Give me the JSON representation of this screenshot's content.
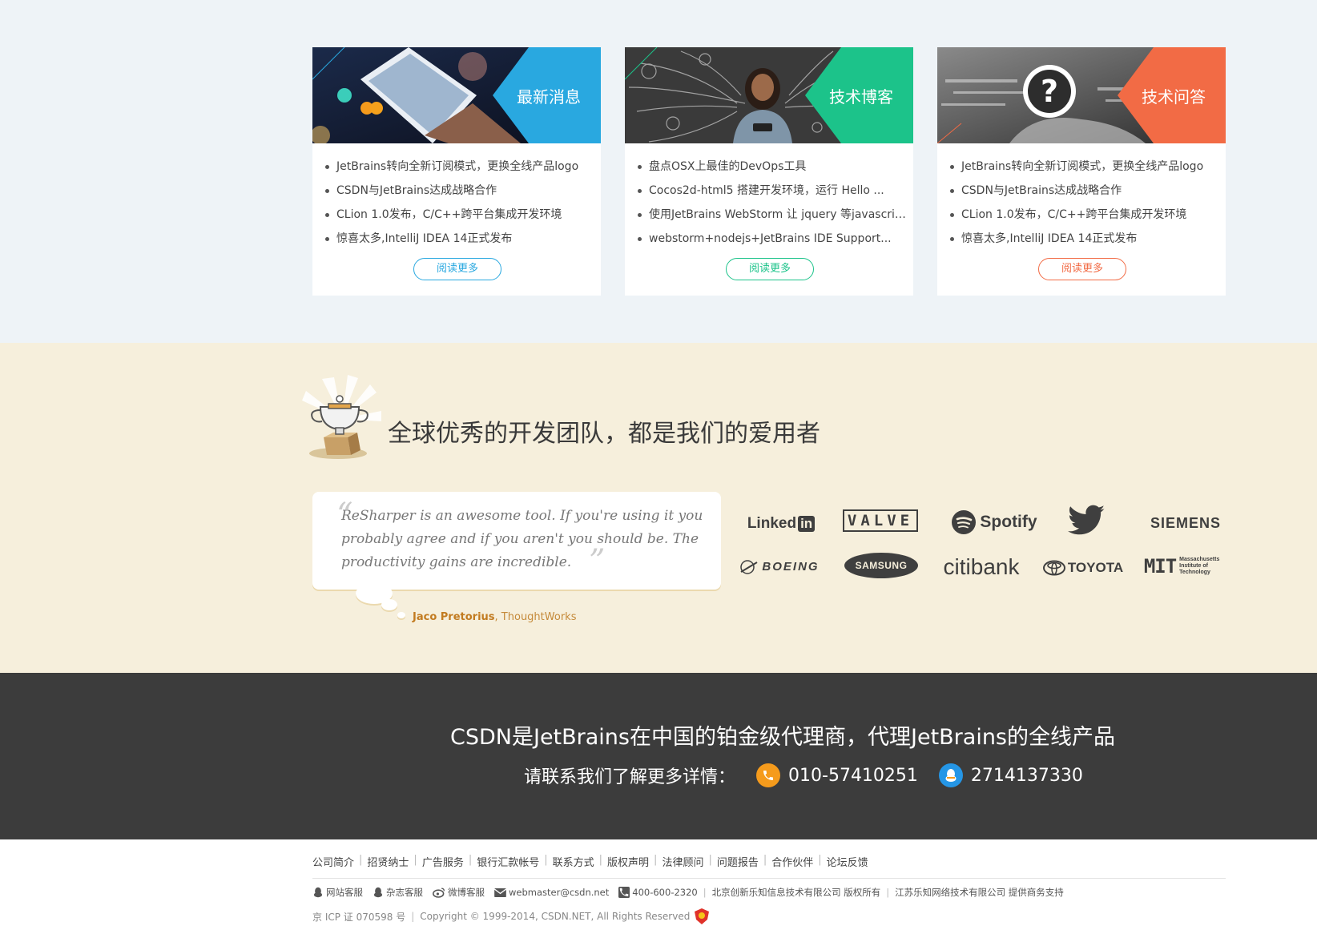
{
  "colors": {
    "news_accent": "#29a8e0",
    "blog_accent": "#1cc38a",
    "qa_accent": "#f26b45",
    "users_bg": "#f6efdc",
    "contact_bg": "#3c3c3c"
  },
  "cards": [
    {
      "title": "最新消息",
      "items": [
        "JetBrains转向全新订阅模式，更换全线产品logo",
        "CSDN与JetBrains达成战略合作",
        "CLion 1.0发布，C/C++跨平台集成开发环境",
        "惊喜太多,IntelliJ IDEA 14正式发布"
      ],
      "more": "阅读更多"
    },
    {
      "title": "技术博客",
      "items": [
        "盘点OSX上最佳的DevOps工具",
        "Cocos2d-html5 搭建开发环境，运行 Hello ...",
        "使用JetBrains WebStorm 让 jquery 等javascript...",
        "webstorm+nodejs+JetBrains IDE Support..."
      ],
      "more": "阅读更多"
    },
    {
      "title": "技术问答",
      "items": [
        "JetBrains转向全新订阅模式，更换全线产品logo",
        "CSDN与JetBrains达成战略合作",
        "CLion 1.0发布，C/C++跨平台集成开发环境",
        "惊喜太多,IntelliJ IDEA 14正式发布"
      ],
      "more": "阅读更多"
    }
  ],
  "users": {
    "title": "全球优秀的开发团队，都是我们的爱用者",
    "quote": "ReSharper is an awesome tool. If you're using it you probably agree and if you aren't you should be. The productivity gains are incredible.",
    "author_name": "Jaco Pretorius",
    "author_company": ", ThoughtWorks",
    "logos": {
      "linkedin": "Linked",
      "linkedin_in": "in",
      "valve": "VALVE",
      "spotify": "Spotify",
      "siemens": "SIEMENS",
      "boeing": "BOEING",
      "samsung": "SAMSUNG",
      "citibank": "citibank",
      "toyota": "TOYOTA",
      "mit": "MIT",
      "mit_full": "Massachusetts Institute of Technology"
    }
  },
  "contact": {
    "headline": "CSDN是JetBrains在中国的铂金级代理商，代理JetBrains的全线产品",
    "prompt": "请联系我们了解更多详情：",
    "phone": "010-57410251",
    "qq": "2714137330"
  },
  "footer": {
    "nav": [
      "公司简介",
      "招贤纳士",
      "广告服务",
      "银行汇款帐号",
      "联系方式",
      "版权声明",
      "法律顾问",
      "问题报告",
      "合作伙伴",
      "论坛反馈"
    ],
    "site_service": "网站客服",
    "magazine_service": "杂志客服",
    "weibo_service": "微博客服",
    "email": "webmaster@csdn.net",
    "phone": "400-600-2320",
    "company1": "北京创新乐知信息技术有限公司 版权所有",
    "company2": "江苏乐知网络技术有限公司 提供商务支持",
    "icp": "京 ICP 证 070598 号",
    "copyright": "Copyright © 1999-2014, CSDN.NET, All Rights Reserved"
  }
}
